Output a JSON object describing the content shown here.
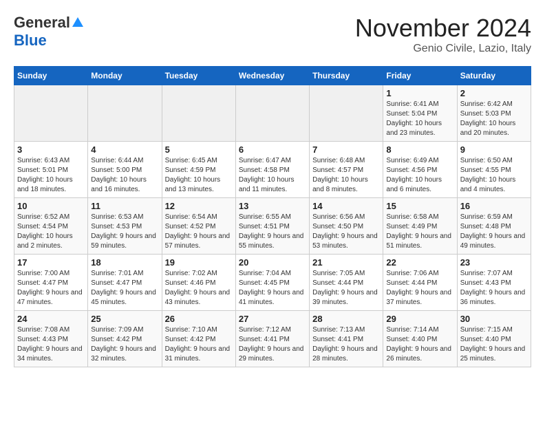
{
  "header": {
    "logo_line1": "General",
    "logo_line2": "Blue",
    "title": "November 2024",
    "subtitle": "Genio Civile, Lazio, Italy"
  },
  "calendar": {
    "weekdays": [
      "Sunday",
      "Monday",
      "Tuesday",
      "Wednesday",
      "Thursday",
      "Friday",
      "Saturday"
    ],
    "weeks": [
      [
        {
          "day": "",
          "empty": true
        },
        {
          "day": "",
          "empty": true
        },
        {
          "day": "",
          "empty": true
        },
        {
          "day": "",
          "empty": true
        },
        {
          "day": "",
          "empty": true
        },
        {
          "day": "1",
          "sunrise": "6:41 AM",
          "sunset": "5:04 PM",
          "daylight": "10 hours and 23 minutes."
        },
        {
          "day": "2",
          "sunrise": "6:42 AM",
          "sunset": "5:03 PM",
          "daylight": "10 hours and 20 minutes."
        }
      ],
      [
        {
          "day": "3",
          "sunrise": "6:43 AM",
          "sunset": "5:01 PM",
          "daylight": "10 hours and 18 minutes."
        },
        {
          "day": "4",
          "sunrise": "6:44 AM",
          "sunset": "5:00 PM",
          "daylight": "10 hours and 16 minutes."
        },
        {
          "day": "5",
          "sunrise": "6:45 AM",
          "sunset": "4:59 PM",
          "daylight": "10 hours and 13 minutes."
        },
        {
          "day": "6",
          "sunrise": "6:47 AM",
          "sunset": "4:58 PM",
          "daylight": "10 hours and 11 minutes."
        },
        {
          "day": "7",
          "sunrise": "6:48 AM",
          "sunset": "4:57 PM",
          "daylight": "10 hours and 8 minutes."
        },
        {
          "day": "8",
          "sunrise": "6:49 AM",
          "sunset": "4:56 PM",
          "daylight": "10 hours and 6 minutes."
        },
        {
          "day": "9",
          "sunrise": "6:50 AM",
          "sunset": "4:55 PM",
          "daylight": "10 hours and 4 minutes."
        }
      ],
      [
        {
          "day": "10",
          "sunrise": "6:52 AM",
          "sunset": "4:54 PM",
          "daylight": "10 hours and 2 minutes."
        },
        {
          "day": "11",
          "sunrise": "6:53 AM",
          "sunset": "4:53 PM",
          "daylight": "9 hours and 59 minutes."
        },
        {
          "day": "12",
          "sunrise": "6:54 AM",
          "sunset": "4:52 PM",
          "daylight": "9 hours and 57 minutes."
        },
        {
          "day": "13",
          "sunrise": "6:55 AM",
          "sunset": "4:51 PM",
          "daylight": "9 hours and 55 minutes."
        },
        {
          "day": "14",
          "sunrise": "6:56 AM",
          "sunset": "4:50 PM",
          "daylight": "9 hours and 53 minutes."
        },
        {
          "day": "15",
          "sunrise": "6:58 AM",
          "sunset": "4:49 PM",
          "daylight": "9 hours and 51 minutes."
        },
        {
          "day": "16",
          "sunrise": "6:59 AM",
          "sunset": "4:48 PM",
          "daylight": "9 hours and 49 minutes."
        }
      ],
      [
        {
          "day": "17",
          "sunrise": "7:00 AM",
          "sunset": "4:47 PM",
          "daylight": "9 hours and 47 minutes."
        },
        {
          "day": "18",
          "sunrise": "7:01 AM",
          "sunset": "4:47 PM",
          "daylight": "9 hours and 45 minutes."
        },
        {
          "day": "19",
          "sunrise": "7:02 AM",
          "sunset": "4:46 PM",
          "daylight": "9 hours and 43 minutes."
        },
        {
          "day": "20",
          "sunrise": "7:04 AM",
          "sunset": "4:45 PM",
          "daylight": "9 hours and 41 minutes."
        },
        {
          "day": "21",
          "sunrise": "7:05 AM",
          "sunset": "4:44 PM",
          "daylight": "9 hours and 39 minutes."
        },
        {
          "day": "22",
          "sunrise": "7:06 AM",
          "sunset": "4:44 PM",
          "daylight": "9 hours and 37 minutes."
        },
        {
          "day": "23",
          "sunrise": "7:07 AM",
          "sunset": "4:43 PM",
          "daylight": "9 hours and 36 minutes."
        }
      ],
      [
        {
          "day": "24",
          "sunrise": "7:08 AM",
          "sunset": "4:43 PM",
          "daylight": "9 hours and 34 minutes."
        },
        {
          "day": "25",
          "sunrise": "7:09 AM",
          "sunset": "4:42 PM",
          "daylight": "9 hours and 32 minutes."
        },
        {
          "day": "26",
          "sunrise": "7:10 AM",
          "sunset": "4:42 PM",
          "daylight": "9 hours and 31 minutes."
        },
        {
          "day": "27",
          "sunrise": "7:12 AM",
          "sunset": "4:41 PM",
          "daylight": "9 hours and 29 minutes."
        },
        {
          "day": "28",
          "sunrise": "7:13 AM",
          "sunset": "4:41 PM",
          "daylight": "9 hours and 28 minutes."
        },
        {
          "day": "29",
          "sunrise": "7:14 AM",
          "sunset": "4:40 PM",
          "daylight": "9 hours and 26 minutes."
        },
        {
          "day": "30",
          "sunrise": "7:15 AM",
          "sunset": "4:40 PM",
          "daylight": "9 hours and 25 minutes."
        }
      ]
    ]
  }
}
